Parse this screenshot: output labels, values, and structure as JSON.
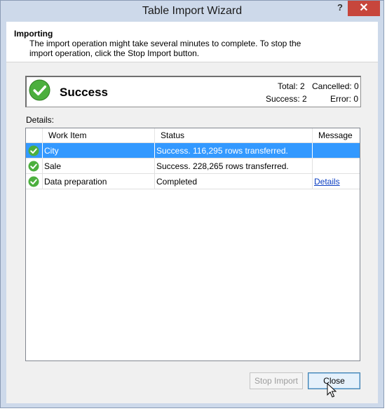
{
  "window": {
    "title": "Table Import Wizard",
    "help_glyph": "?",
    "close_glyph": "✕"
  },
  "header": {
    "title": "Importing",
    "description": "The import operation might take several minutes to complete. To stop the import operation, click the Stop Import button."
  },
  "summary": {
    "status": "Success",
    "total": "Total: 2",
    "cancelled": "Cancelled: 0",
    "success": "Success: 2",
    "error": "Error: 0"
  },
  "details": {
    "label": "Details:",
    "columns": [
      "Work Item",
      "Status",
      "Message"
    ],
    "rows": [
      {
        "work_item": "City",
        "status": "Success. 116,295 rows transferred.",
        "message": "",
        "selected": true
      },
      {
        "work_item": "Sale",
        "status": "Success. 228,265 rows transferred.",
        "message": "",
        "selected": false
      },
      {
        "work_item": "Data preparation",
        "status": "Completed",
        "message": "Details",
        "selected": false
      }
    ]
  },
  "buttons": {
    "stop_import": "Stop Import",
    "close": "Close"
  },
  "icons": {
    "success": "check-circle-icon"
  },
  "colors": {
    "success_green": "#4caf3e",
    "selection": "#3399ff",
    "close_button": "#c7463c",
    "link": "#0b3ec2"
  }
}
